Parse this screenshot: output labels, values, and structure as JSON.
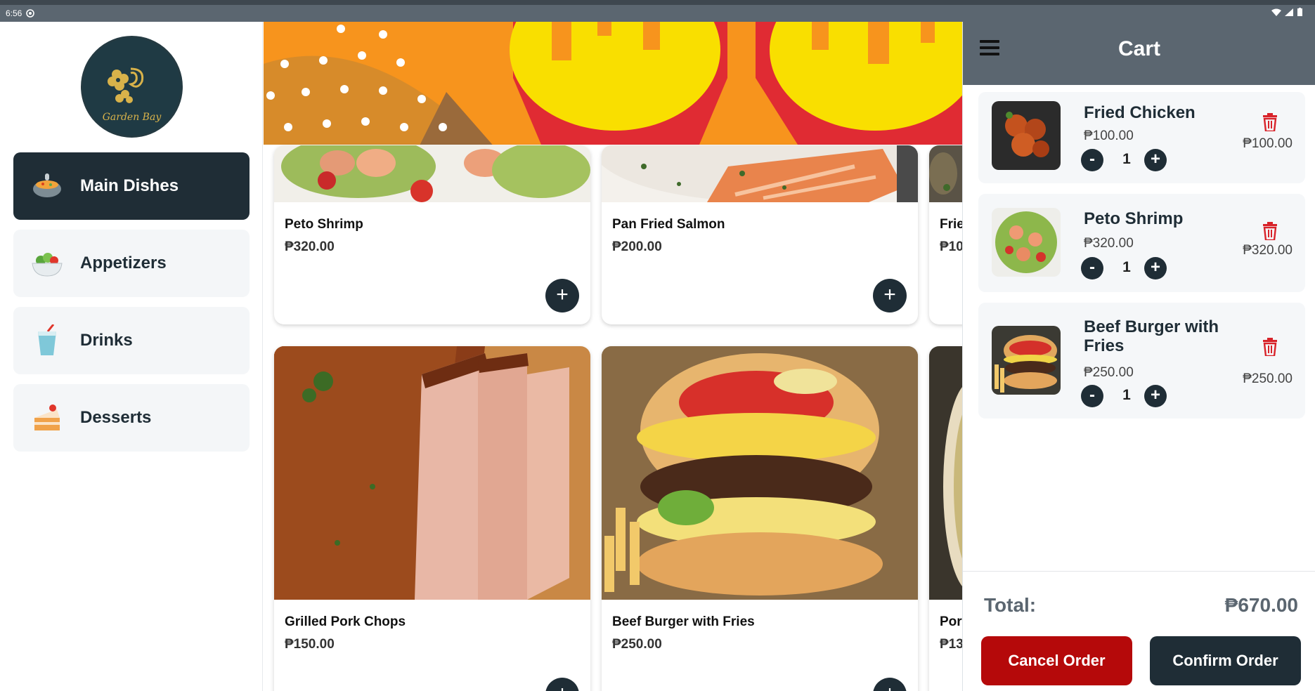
{
  "status_bar": {
    "time": "6:56"
  },
  "sidebar": {
    "logo_text": "Garden Bay",
    "categories": [
      {
        "label": "Main Dishes",
        "icon": "curry-pot-icon",
        "active": true
      },
      {
        "label": "Appetizers",
        "icon": "salad-bowl-icon",
        "active": false
      },
      {
        "label": "Drinks",
        "icon": "drink-cup-icon",
        "active": false
      },
      {
        "label": "Desserts",
        "icon": "cake-slice-icon",
        "active": false
      }
    ]
  },
  "menu": {
    "items": [
      {
        "name": "Peto Shrimp",
        "price": "₱320.00"
      },
      {
        "name": "Pan Fried Salmon",
        "price": "₱200.00"
      },
      {
        "name": "Frie",
        "price": "₱10"
      },
      {
        "name": "Grilled Pork Chops",
        "price": "₱150.00"
      },
      {
        "name": "Beef Burger with Fries",
        "price": "₱250.00"
      },
      {
        "name": "Por",
        "price": "₱13"
      }
    ],
    "add_label": "+"
  },
  "cart": {
    "title": "Cart",
    "items": [
      {
        "name": "Fried Chicken",
        "price": "₱100.00",
        "qty": "1",
        "subtotal": "₱100.00"
      },
      {
        "name": "Peto Shrimp",
        "price": "₱320.00",
        "qty": "1",
        "subtotal": "₱320.00"
      },
      {
        "name": "Beef Burger with Fries",
        "price": "₱250.00",
        "qty": "1",
        "subtotal": "₱250.00"
      }
    ],
    "minus_label": "-",
    "plus_label": "+",
    "total_label": "Total:",
    "total_value": "₱670.00",
    "cancel_label": "Cancel Order",
    "confirm_label": "Confirm Order"
  },
  "colors": {
    "dark": "#1f2d36",
    "header": "#5b6670",
    "danger": "#b5090a",
    "accent_gold": "#d8b24a"
  }
}
